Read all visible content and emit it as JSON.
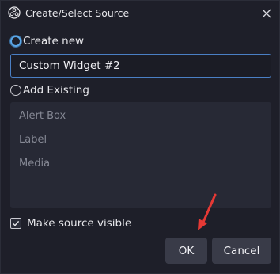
{
  "window": {
    "title": "Create/Select Source",
    "app_icon": "obs-logo-icon",
    "close_icon": "close-icon"
  },
  "create_new": {
    "label": "Create new",
    "selected": true,
    "input_value": "Custom Widget #2"
  },
  "add_existing": {
    "label": "Add Existing",
    "selected": false,
    "items": [
      "Alert Box",
      "Label",
      "Media"
    ]
  },
  "make_visible": {
    "label": "Make source visible",
    "checked": true
  },
  "buttons": {
    "ok_label": "OK",
    "cancel_label": "Cancel"
  },
  "annotation": {
    "arrow_color": "#e53935",
    "arrow_target": "ok-button"
  },
  "colors": {
    "background": "#1e1f29",
    "input_border": "#4a7fc4",
    "radio_accent": "#5aa7e8",
    "button_bg": "#393b48",
    "list_bg": "#272935"
  }
}
